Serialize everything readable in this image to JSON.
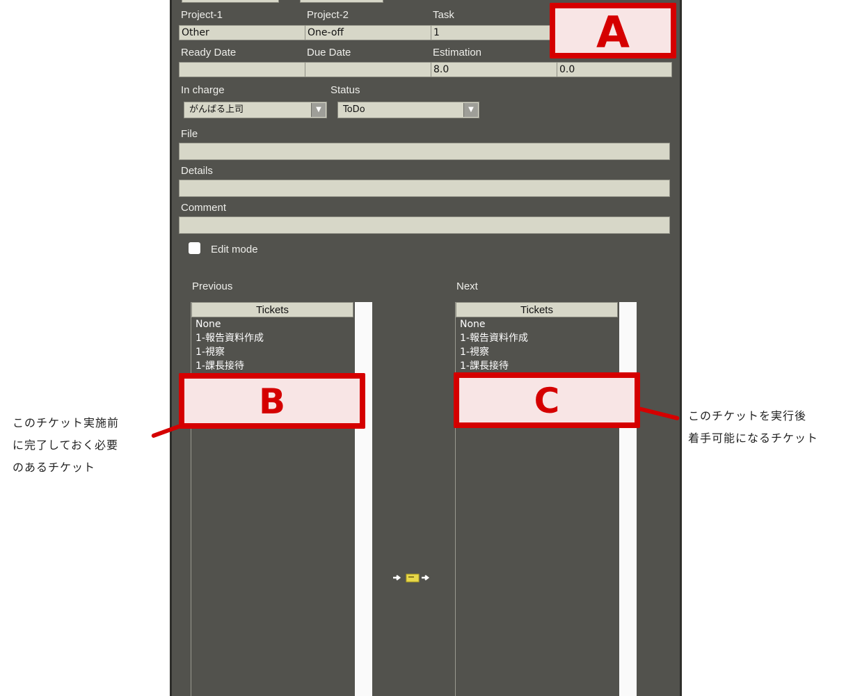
{
  "labels": {
    "project1": "Project-1",
    "project2": "Project-2",
    "task": "Task",
    "ready_date": "Ready Date",
    "due_date": "Due Date",
    "estimation": "Estimation",
    "in_charge": "In charge",
    "status": "Status",
    "file": "File",
    "details": "Details",
    "comment": "Comment",
    "edit_mode": "Edit mode",
    "previous": "Previous",
    "next": "Next"
  },
  "fields": {
    "project1": "Other",
    "project2": "One-off",
    "task": "1",
    "ready_date": "",
    "due_date": "",
    "estimation": "8.0",
    "estimation2": "0.0",
    "file": "",
    "details": "",
    "comment": ""
  },
  "selects": {
    "in_charge": "がんばる上司",
    "status": "ToDo"
  },
  "edit_mode_checked": false,
  "previous_list": {
    "header": "Tickets",
    "items": [
      "None",
      "1-報告資料作成",
      "1-視察",
      "1-課長接待"
    ]
  },
  "next_list": {
    "header": "Tickets",
    "items": [
      "None",
      "1-報告資料作成",
      "1-視察",
      "1-課長接待"
    ]
  },
  "annotations": {
    "a_label": "A",
    "b_label": "B",
    "c_label": "C",
    "left_note": [
      "このチケット実施前",
      "に完了しておく必要",
      "のあるチケット"
    ],
    "right_note": [
      "このチケットを実行後",
      "着手可能になるチケット"
    ]
  },
  "colors": {
    "panel_bg": "#52524d",
    "field_bg": "#d7d7c8",
    "annotation_red": "#d50000"
  },
  "icons": {
    "link": "arrow-ticket-arrow-icon"
  }
}
